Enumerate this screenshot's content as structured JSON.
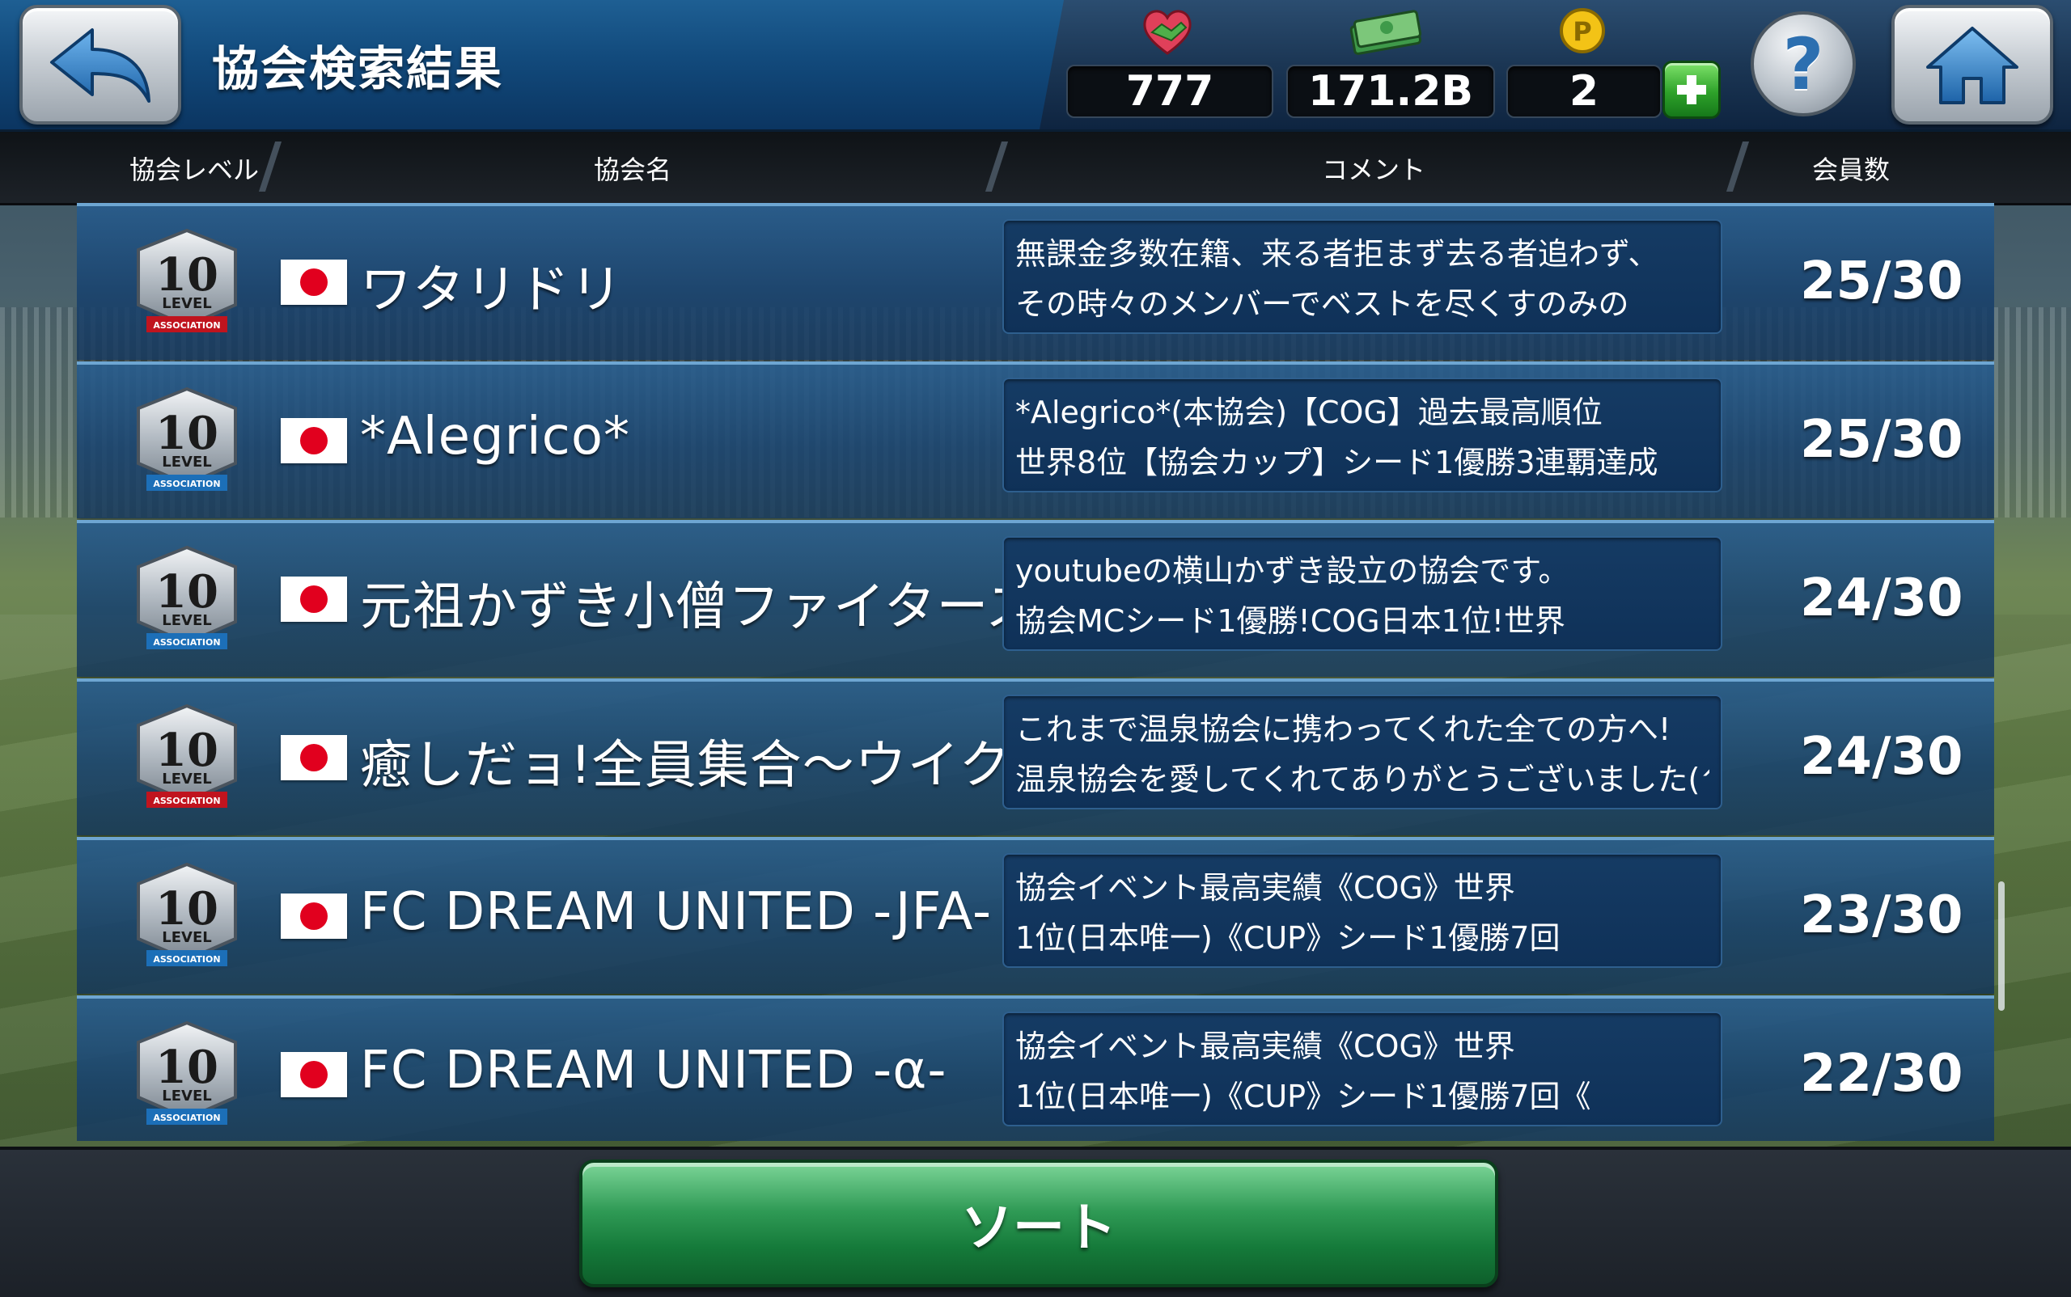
{
  "header": {
    "title": "協会検索結果",
    "stats": {
      "hearts": "777",
      "money": "171.2B",
      "points": "2"
    }
  },
  "columns": {
    "level": "協会レベル",
    "name": "協会名",
    "comment": "コメント",
    "members": "会員数"
  },
  "associations": [
    {
      "level": "10",
      "level_label": "LEVEL",
      "ribbon": "ASSOCIATION",
      "ribbon_color": "#c0141e",
      "flag": "jp",
      "name": "ワタリドリ",
      "comment1": "無課金多数在籍、来る者拒まず去る者追わず、",
      "comment2": "その時々のメンバーでベストを尽くすのみの",
      "members": "25/30"
    },
    {
      "level": "10",
      "level_label": "LEVEL",
      "ribbon": "ASSOCIATION",
      "ribbon_color": "#1c6fb8",
      "flag": "jp",
      "name": "*Alegrico*",
      "comment1": "*Alegrico*(本協会)【COG】過去最高順位",
      "comment2": "世界8位【協会カップ】シード1優勝3連覇達成",
      "members": "25/30"
    },
    {
      "level": "10",
      "level_label": "LEVEL",
      "ribbon": "ASSOCIATION",
      "ribbon_color": "#1c6fb8",
      "flag": "jp",
      "name": "元祖かずき小僧ファイターズ",
      "comment1": "youtubeの横山かずき設立の協会です。",
      "comment2": "協会MCシード1優勝!COG日本1位!世界",
      "members": "24/30"
    },
    {
      "level": "10",
      "level_label": "LEVEL",
      "ribbon": "ASSOCIATION",
      "ribbon_color": "#c0141e",
      "flag": "jp",
      "name": "癒しだョ!全員集合〜ウイクラ卒業〜",
      "comment1": "これまで温泉協会に携わってくれた全ての方へ!",
      "comment2": "温泉協会を愛してくれてありがとうございました(^",
      "members": "24/30"
    },
    {
      "level": "10",
      "level_label": "LEVEL",
      "ribbon": "ASSOCIATION",
      "ribbon_color": "#1c6fb8",
      "flag": "jp",
      "name": "FC DREAM UNITED -JFA-",
      "comment1": "協会イベント最高実績《COG》世界",
      "comment2": "1位(日本唯一)《CUP》シード1優勝7回",
      "members": "23/30"
    },
    {
      "level": "10",
      "level_label": "LEVEL",
      "ribbon": "ASSOCIATION",
      "ribbon_color": "#1c6fb8",
      "flag": "jp",
      "name": "FC DREAM UNITED -α-",
      "comment1": "協会イベント最高実績《COG》世界",
      "comment2": "1位(日本唯一)《CUP》シード1優勝7回《",
      "members": "22/30"
    }
  ],
  "footer": {
    "sort_label": "ソート"
  },
  "icons": {
    "back": "back-arrow-icon",
    "home": "home-icon",
    "help": "help-icon",
    "hearts": "handshake-heart-icon",
    "money": "money-stack-icon",
    "points": "p-coin-icon",
    "plus": "plus-icon"
  }
}
